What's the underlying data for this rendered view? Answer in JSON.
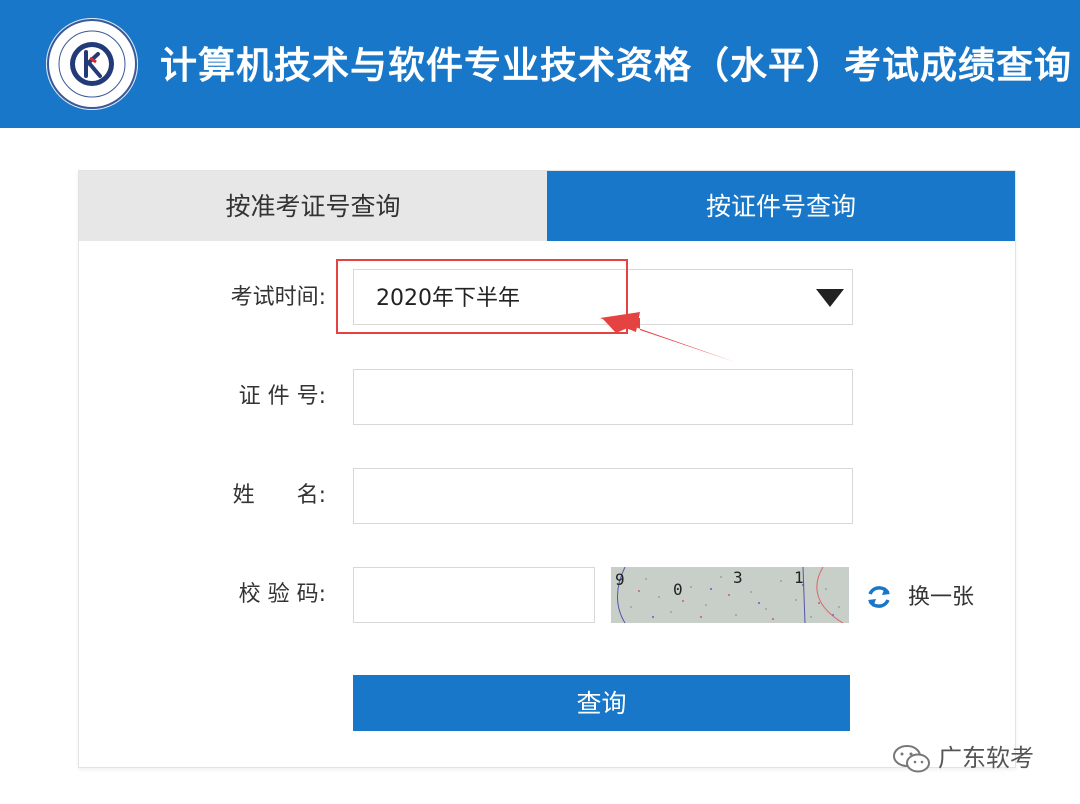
{
  "header": {
    "title": "计算机技术与软件专业技术资格（水平）考试成绩查询",
    "logo_icon": "exam-seal-logo",
    "background_color": "#1877c8"
  },
  "tabs": [
    {
      "label": "按准考证号查询",
      "active": false
    },
    {
      "label": "按证件号查询",
      "active": true
    }
  ],
  "form": {
    "exam_time_label": "考试时间:",
    "exam_time_value": "2020年下半年",
    "id_label": "证 件 号:",
    "id_value": "",
    "name_label": "姓      名:",
    "name_value": "",
    "captcha_label": "校 验 码:",
    "captcha_value": "",
    "captcha_text": [
      "9",
      "0",
      "3",
      "1"
    ],
    "refresh_label": "换一张",
    "submit_label": "查询"
  },
  "watermark": {
    "text": "广东软考",
    "icon": "wechat-icon"
  },
  "colors": {
    "accent": "#1877c8",
    "annotation": "#e54242"
  }
}
